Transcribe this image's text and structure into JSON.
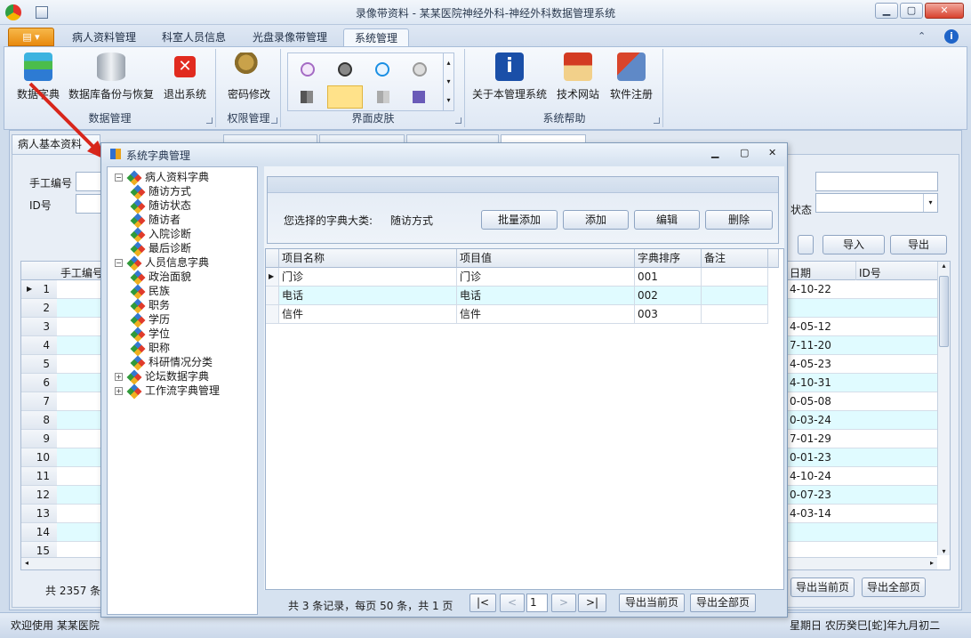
{
  "window": {
    "title": "录像带资料 - 某某医院神经外科-神经外科数据管理系统"
  },
  "ribbon_tabs": [
    "病人资料管理",
    "科室人员信息",
    "光盘录像带管理",
    "系统管理"
  ],
  "ribbon": {
    "groups": [
      {
        "label": "数据管理",
        "buttons": [
          "数据字典",
          "数据库备份与恢复",
          "退出系统"
        ]
      },
      {
        "label": "权限管理",
        "buttons": [
          "密码修改"
        ]
      },
      {
        "label": "界面皮肤",
        "buttons": []
      },
      {
        "label": "系统帮助",
        "buttons": [
          "关于本管理系统",
          "技术网站",
          "软件注册"
        ]
      }
    ]
  },
  "background": {
    "tab": "病人基本资料",
    "fields": {
      "manual_no": "手工编号",
      "id_no": "ID号",
      "status": "状态"
    },
    "buttons": {
      "import": "导入",
      "export": "导出",
      "export_current": "导出当前页",
      "export_all": "导出全部页"
    },
    "columns": {
      "manual_no": "手工编号",
      "date": "日期",
      "id_no": "ID号"
    },
    "rows": [
      "1",
      "2",
      "3",
      "4",
      "5",
      "6",
      "7",
      "8",
      "9",
      "10",
      "11",
      "12",
      "13",
      "14",
      "15"
    ],
    "dates": [
      "4-10-22",
      "",
      "4-05-12",
      "7-11-20",
      "4-05-23",
      "4-10-31",
      "0-05-08",
      "0-03-24",
      "7-01-29",
      "0-01-23",
      "4-10-24",
      "0-07-23",
      "4-03-14",
      "",
      ""
    ],
    "total": "共 2357 条",
    "statusbar": {
      "left": "欢迎使用 某某医院",
      "right": "星期日 农历癸巳[蛇]年九月初二"
    }
  },
  "dialog": {
    "title": "系统字典管理",
    "tree": [
      {
        "label": "病人资料字典",
        "level": 0,
        "expanded": true
      },
      {
        "label": "随访方式",
        "level": 1
      },
      {
        "label": "随访状态",
        "level": 1
      },
      {
        "label": "随访者",
        "level": 1
      },
      {
        "label": "入院诊断",
        "level": 1
      },
      {
        "label": "最后诊断",
        "level": 1
      },
      {
        "label": "人员信息字典",
        "level": 0,
        "expanded": true
      },
      {
        "label": "政治面貌",
        "level": 1
      },
      {
        "label": "民族",
        "level": 1
      },
      {
        "label": "职务",
        "level": 1
      },
      {
        "label": "学历",
        "level": 1
      },
      {
        "label": "学位",
        "level": 1
      },
      {
        "label": "职称",
        "level": 1
      },
      {
        "label": "科研情况分类",
        "level": 1
      },
      {
        "label": "论坛数据字典",
        "level": 0,
        "expanded": false
      },
      {
        "label": "工作流字典管理",
        "level": 0,
        "expanded": false
      }
    ],
    "selected_label": "您选择的字典大类:",
    "selected_value": "随访方式",
    "buttons": {
      "batch_add": "批量添加",
      "add": "添加",
      "edit": "编辑",
      "delete": "删除"
    },
    "columns": [
      "项目名称",
      "项目值",
      "字典排序",
      "备注"
    ],
    "rows": [
      {
        "name": "门诊",
        "value": "门诊",
        "order": "001",
        "note": ""
      },
      {
        "name": "电话",
        "value": "电话",
        "order": "002",
        "note": ""
      },
      {
        "name": "信件",
        "value": "信件",
        "order": "003",
        "note": ""
      }
    ],
    "pager": {
      "summary": "共 3 条记录，每页 50 条，共 1 页",
      "first": "|<",
      "prev": "<",
      "page": "1",
      "next": ">",
      "last": ">|",
      "export_current": "导出当前页",
      "export_all": "导出全部页"
    }
  },
  "colors": {
    "accent": "#e88a0e",
    "selected_row": "#e0fbff",
    "ribbon_bg": "#dfe8f4"
  }
}
